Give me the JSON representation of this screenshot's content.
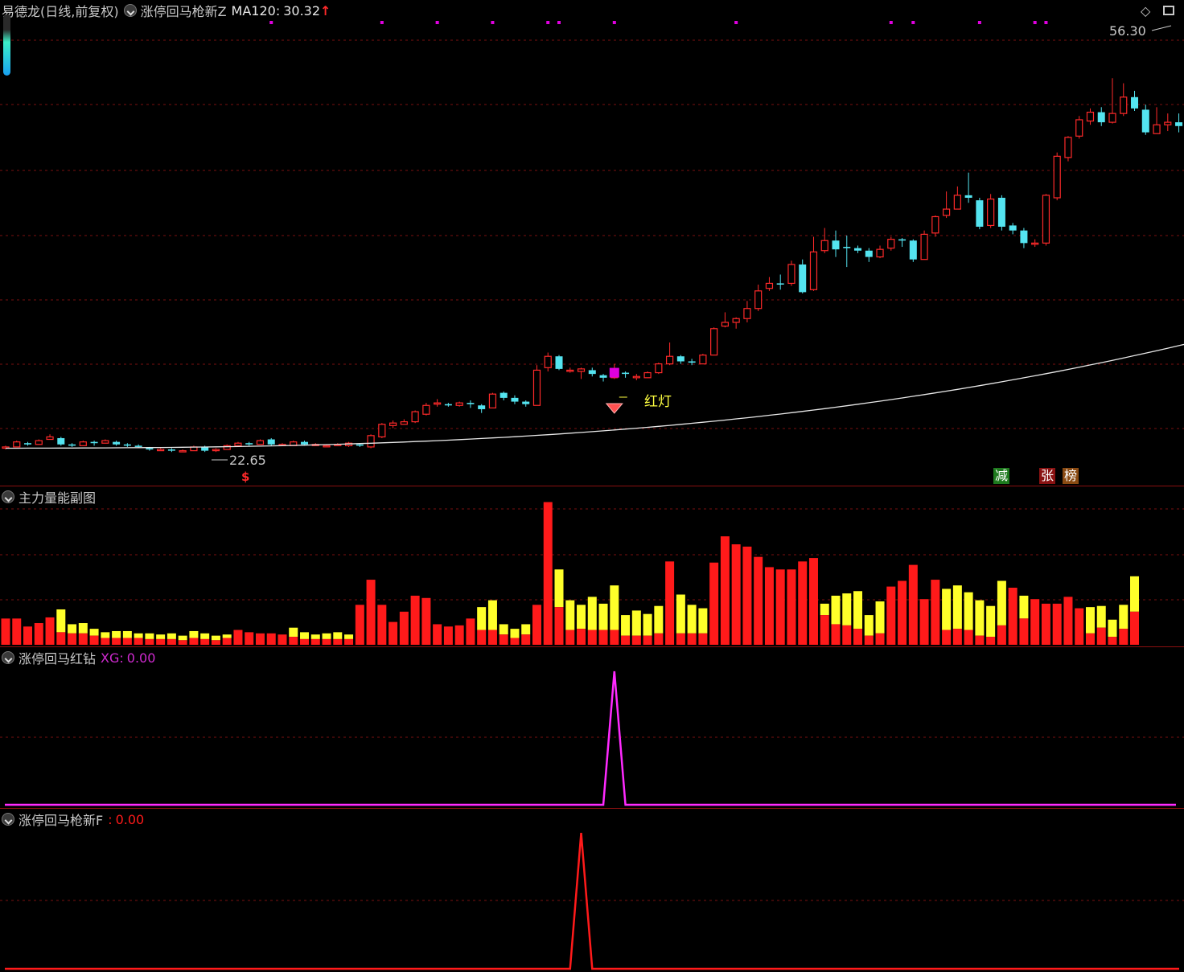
{
  "main_chart": {
    "title": "易德龙(日线,前复权)",
    "indicator_name": "涨停回马枪新Z",
    "ma_label": "MA120:",
    "ma_value": "30.32",
    "ma_arrow": "↑",
    "high_label": "56.30",
    "low_label": "22.65",
    "signal_label": "红灯",
    "buy_marker": "$",
    "badges": [
      "减",
      "张",
      "榜"
    ],
    "colors": {
      "up": "#ff2a2a",
      "down": "#54e4f0",
      "ma": "#e8e8e8",
      "marker": "#e000e0",
      "signal_text": "#ffff40"
    }
  },
  "volume_panel": {
    "title": "主力量能副图",
    "colors": {
      "red": "#ff1a1a",
      "yellow": "#ffff2a"
    }
  },
  "xg_panel": {
    "title": "涨停回马红钻",
    "label": "XG:",
    "value": "0.00",
    "color": "#ff2aff"
  },
  "f_panel": {
    "title": "涨停回马枪新F",
    "label": ":",
    "value": "0.00",
    "color": "#ff1a1a"
  },
  "icons": [
    "chevron-down-icon",
    "diamond-icon",
    "window-icon"
  ],
  "candles": [
    [
      22.6,
      22.7,
      22.8,
      22.5
    ],
    [
      22.7,
      23.1,
      23.2,
      22.7
    ],
    [
      23.0,
      22.9,
      23.1,
      22.8
    ],
    [
      22.9,
      23.2,
      23.3,
      22.9
    ],
    [
      23.3,
      23.5,
      23.7,
      23.3
    ],
    [
      23.4,
      22.9,
      23.5,
      22.8
    ],
    [
      22.9,
      22.8,
      23.0,
      22.7
    ],
    [
      22.8,
      23.1,
      23.2,
      22.8
    ],
    [
      23.1,
      23.0,
      23.2,
      22.8
    ],
    [
      23.0,
      23.2,
      23.3,
      23.0
    ],
    [
      23.1,
      22.9,
      23.2,
      22.8
    ],
    [
      22.9,
      22.8,
      23.0,
      22.7
    ],
    [
      22.8,
      22.7,
      22.9,
      22.6
    ],
    [
      22.6,
      22.5,
      22.7,
      22.4
    ],
    [
      22.4,
      22.5,
      22.6,
      22.4
    ],
    [
      22.5,
      22.4,
      22.6,
      22.3
    ],
    [
      22.4,
      22.4,
      22.5,
      22.3
    ],
    [
      22.4,
      22.7,
      22.8,
      22.4
    ],
    [
      22.7,
      22.4,
      22.8,
      22.3
    ],
    [
      22.4,
      22.5,
      22.6,
      22.3
    ],
    [
      22.5,
      22.8,
      22.9,
      22.5
    ],
    [
      22.8,
      23.0,
      23.1,
      22.7
    ],
    [
      23.0,
      22.9,
      23.1,
      22.8
    ],
    [
      22.9,
      23.2,
      23.3,
      22.9
    ],
    [
      23.3,
      22.9,
      23.4,
      22.8
    ],
    [
      22.9,
      22.9,
      23.0,
      22.8
    ],
    [
      22.8,
      23.1,
      23.2,
      22.8
    ],
    [
      23.1,
      22.9,
      23.2,
      22.8
    ],
    [
      22.9,
      22.9,
      23.0,
      22.8
    ],
    [
      22.8,
      22.8,
      22.9,
      22.7
    ],
    [
      22.9,
      22.9,
      23.0,
      22.8
    ],
    [
      22.8,
      23.0,
      23.1,
      22.7
    ],
    [
      22.9,
      22.8,
      23.0,
      22.7
    ],
    [
      22.7,
      23.6,
      23.7,
      22.6
    ],
    [
      23.5,
      24.5,
      24.6,
      23.4
    ],
    [
      24.4,
      24.6,
      24.8,
      24.2
    ],
    [
      24.5,
      24.7,
      24.9,
      24.5
    ],
    [
      24.7,
      25.5,
      25.6,
      24.6
    ],
    [
      25.3,
      26.0,
      26.2,
      25.2
    ],
    [
      26.1,
      26.2,
      26.5,
      25.9
    ],
    [
      26.1,
      26.0,
      26.2,
      25.9
    ],
    [
      26.0,
      26.2,
      26.3,
      25.9
    ],
    [
      26.2,
      26.1,
      26.4,
      25.8
    ],
    [
      26.0,
      25.7,
      26.1,
      25.4
    ],
    [
      25.8,
      26.9,
      27.0,
      25.8
    ],
    [
      27.0,
      26.6,
      27.1,
      26.4
    ],
    [
      26.6,
      26.3,
      26.8,
      26.1
    ],
    [
      26.3,
      26.1,
      26.4,
      25.9
    ],
    [
      26.0,
      28.8,
      29.2,
      26.0
    ],
    [
      29.0,
      29.9,
      30.2,
      28.7
    ],
    [
      29.9,
      28.9,
      30.0,
      28.8
    ],
    [
      28.8,
      28.8,
      29.0,
      28.6
    ],
    [
      28.7,
      28.9,
      29.0,
      28.1
    ],
    [
      28.8,
      28.5,
      29.0,
      28.3
    ],
    [
      28.4,
      28.2,
      28.5,
      27.9
    ],
    [
      28.2,
      28.6,
      29.3,
      28.1
    ],
    [
      28.6,
      28.5,
      28.7,
      28.2
    ],
    [
      28.2,
      28.3,
      28.5,
      28.0
    ],
    [
      28.2,
      28.6,
      28.7,
      28.2
    ],
    [
      28.6,
      29.3,
      29.4,
      28.5
    ],
    [
      29.3,
      29.9,
      31.0,
      29.2
    ],
    [
      29.9,
      29.5,
      30.0,
      29.3
    ],
    [
      29.5,
      29.4,
      29.7,
      29.2
    ],
    [
      29.3,
      30.0,
      30.1,
      29.3
    ],
    [
      30.0,
      32.1,
      32.2,
      30.0
    ],
    [
      32.3,
      32.6,
      33.4,
      32.2
    ],
    [
      32.6,
      32.9,
      33.0,
      32.1
    ],
    [
      32.9,
      33.7,
      34.3,
      32.6
    ],
    [
      33.7,
      35.1,
      35.6,
      33.5
    ],
    [
      35.3,
      35.7,
      36.2,
      35.1
    ],
    [
      35.7,
      35.6,
      36.4,
      35.2
    ],
    [
      35.7,
      37.2,
      37.5,
      35.5
    ],
    [
      37.2,
      35.0,
      37.6,
      34.9
    ],
    [
      35.2,
      38.2,
      39.4,
      35.1
    ],
    [
      38.3,
      39.1,
      40.1,
      38.1
    ],
    [
      39.1,
      38.4,
      39.9,
      37.8
    ],
    [
      38.6,
      38.5,
      39.5,
      37.0
    ],
    [
      38.5,
      38.3,
      38.7,
      38.1
    ],
    [
      38.3,
      37.8,
      38.5,
      37.4
    ],
    [
      37.8,
      38.4,
      38.7,
      37.7
    ],
    [
      38.5,
      39.2,
      39.4,
      38.3
    ],
    [
      39.2,
      39.1,
      39.3,
      38.6
    ],
    [
      39.1,
      37.6,
      39.2,
      37.4
    ],
    [
      37.6,
      39.6,
      39.9,
      37.6
    ],
    [
      39.7,
      41.0,
      41.1,
      39.4
    ],
    [
      41.1,
      41.6,
      43.0,
      40.9
    ],
    [
      41.6,
      42.7,
      43.4,
      41.6
    ],
    [
      42.7,
      42.5,
      44.5,
      42.1
    ],
    [
      42.3,
      40.2,
      42.5,
      40.0
    ],
    [
      40.3,
      42.4,
      42.8,
      40.1
    ],
    [
      42.5,
      40.2,
      42.7,
      39.9
    ],
    [
      40.3,
      39.9,
      40.5,
      39.6
    ],
    [
      39.9,
      38.9,
      40.1,
      38.5
    ],
    [
      38.9,
      38.9,
      39.2,
      38.6
    ],
    [
      38.9,
      42.7,
      42.8,
      38.7
    ],
    [
      42.5,
      45.8,
      46.1,
      42.3
    ],
    [
      45.7,
      47.3,
      47.4,
      45.4
    ],
    [
      47.4,
      48.7,
      49.0,
      47.2
    ],
    [
      48.6,
      49.3,
      49.6,
      48.3
    ],
    [
      49.3,
      48.5,
      49.7,
      48.2
    ],
    [
      48.5,
      49.2,
      52.0,
      48.4
    ],
    [
      49.2,
      50.5,
      51.6,
      49.0
    ],
    [
      50.5,
      49.6,
      51.0,
      49.4
    ],
    [
      49.5,
      47.7,
      49.9,
      47.5
    ],
    [
      47.6,
      48.3,
      49.7,
      48.0
    ],
    [
      48.3,
      48.5,
      49.2,
      47.8
    ],
    [
      48.5,
      48.2,
      49.2,
      47.7
    ],
    [
      48.3,
      48.9,
      49.5,
      47.8
    ],
    [
      48.9,
      48.4,
      49.3,
      47.9
    ],
    [
      48.3,
      48.5,
      49.7,
      48.2
    ]
  ],
  "volume": [
    [
      2.3,
      0
    ],
    [
      2.3,
      0
    ],
    [
      1.6,
      0
    ],
    [
      1.9,
      0
    ],
    [
      2.4,
      0
    ],
    [
      1.1,
      2.0
    ],
    [
      1.0,
      0.8
    ],
    [
      1.0,
      0.9
    ],
    [
      0.8,
      0.6
    ],
    [
      0.6,
      0.5
    ],
    [
      0.6,
      0.6
    ],
    [
      0.6,
      0.6
    ],
    [
      0.6,
      0.4
    ],
    [
      0.5,
      0.5
    ],
    [
      0.5,
      0.4
    ],
    [
      0.5,
      0.5
    ],
    [
      0.4,
      0.4
    ],
    [
      0.6,
      0.6
    ],
    [
      0.5,
      0.5
    ],
    [
      0.4,
      0.4
    ],
    [
      0.6,
      0.3
    ],
    [
      1.3,
      0
    ],
    [
      1.1,
      0
    ],
    [
      1.0,
      0
    ],
    [
      1.0,
      0
    ],
    [
      0.9,
      0
    ],
    [
      0.7,
      0.8
    ],
    [
      0.5,
      0.6
    ],
    [
      0.5,
      0.4
    ],
    [
      0.5,
      0.5
    ],
    [
      0.5,
      0.6
    ],
    [
      0.5,
      0.4
    ],
    [
      3.5,
      0
    ],
    [
      5.7,
      0
    ],
    [
      3.5,
      0
    ],
    [
      2.0,
      0
    ],
    [
      2.9,
      0
    ],
    [
      4.3,
      0
    ],
    [
      4.1,
      0
    ],
    [
      1.8,
      0
    ],
    [
      1.6,
      0
    ],
    [
      1.7,
      0
    ],
    [
      2.3,
      0
    ],
    [
      1.3,
      2.0
    ],
    [
      1.3,
      2.6
    ],
    [
      0.9,
      0.9
    ],
    [
      0.6,
      0.8
    ],
    [
      0.9,
      0.9
    ],
    [
      3.5,
      0
    ],
    [
      12.5,
      0
    ],
    [
      3.3,
      3.3
    ],
    [
      1.3,
      2.6
    ],
    [
      1.4,
      2.1
    ],
    [
      1.3,
      2.9
    ],
    [
      1.3,
      2.3
    ],
    [
      1.3,
      3.9
    ],
    [
      0.8,
      1.8
    ],
    [
      0.8,
      2.2
    ],
    [
      0.8,
      1.9
    ],
    [
      1.0,
      2.4
    ],
    [
      7.3,
      0
    ],
    [
      1.0,
      3.4
    ],
    [
      1.0,
      2.5
    ],
    [
      1.0,
      2.2
    ],
    [
      7.2,
      0
    ],
    [
      9.5,
      0
    ],
    [
      8.8,
      0
    ],
    [
      8.6,
      0
    ],
    [
      7.7,
      0
    ],
    [
      6.8,
      0
    ],
    [
      6.6,
      0
    ],
    [
      6.6,
      0
    ],
    [
      7.3,
      0
    ],
    [
      7.6,
      0
    ],
    [
      2.6,
      1.0
    ],
    [
      1.8,
      2.5
    ],
    [
      1.7,
      2.8
    ],
    [
      1.4,
      3.3
    ],
    [
      0.8,
      1.8
    ],
    [
      1.0,
      2.8
    ],
    [
      5.1,
      0
    ],
    [
      5.6,
      0
    ],
    [
      7.0,
      0
    ],
    [
      4.0,
      0
    ],
    [
      5.7,
      0
    ],
    [
      1.3,
      3.6
    ],
    [
      1.4,
      3.8
    ],
    [
      1.3,
      3.3
    ],
    [
      0.8,
      3.1
    ],
    [
      0.7,
      2.7
    ],
    [
      1.7,
      3.9
    ],
    [
      5.0,
      0
    ],
    [
      2.3,
      2.0
    ],
    [
      4.0,
      0
    ],
    [
      3.6,
      0
    ],
    [
      3.6,
      0
    ],
    [
      4.2,
      0
    ],
    [
      3.2,
      0
    ],
    [
      1.0,
      2.3
    ],
    [
      1.5,
      1.9
    ],
    [
      0.7,
      1.5
    ],
    [
      1.4,
      2.1
    ],
    [
      2.9,
      3.1
    ]
  ],
  "xg_peak_index": 55,
  "f_peak_index": 52,
  "signal_index": 55,
  "buy_index": 20,
  "top_dots": [
    24,
    34,
    39,
    44,
    49,
    50,
    55,
    66,
    80,
    82,
    88,
    93,
    94
  ]
}
